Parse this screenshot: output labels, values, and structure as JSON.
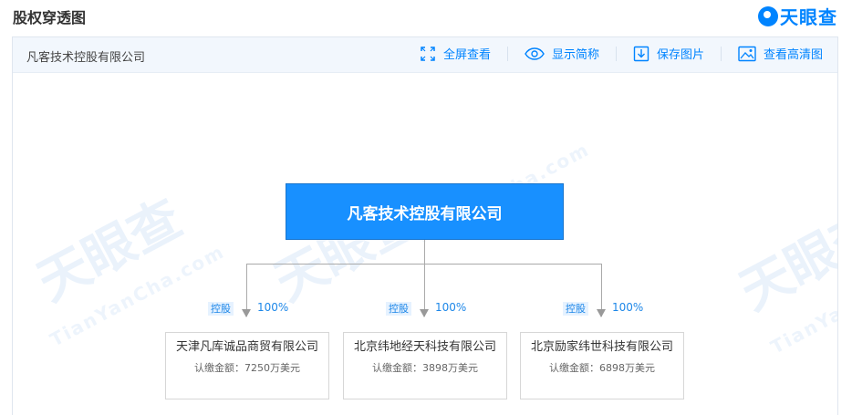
{
  "header": {
    "title": "股权穿透图",
    "brand": "天眼查"
  },
  "toolbar": {
    "company": "凡客技术控股有限公司",
    "tools": [
      {
        "label": "全屏查看",
        "icon": "fullscreen-icon"
      },
      {
        "label": "显示简称",
        "icon": "eye-icon"
      },
      {
        "label": "保存图片",
        "icon": "download-icon"
      },
      {
        "label": "查看高清图",
        "icon": "image-icon"
      }
    ]
  },
  "watermark": {
    "text": "天眼查",
    "sub": "TianYanCha.com"
  },
  "root": {
    "name": "凡客技术控股有限公司"
  },
  "children": [
    {
      "name": "天津凡库诚品商贸有限公司",
      "relation": "控股",
      "percent": "100%",
      "amount": "认缴金额：7250万美元"
    },
    {
      "name": "北京纬地经天科技有限公司",
      "relation": "控股",
      "percent": "100%",
      "amount": "认缴金额：3898万美元"
    },
    {
      "name": "北京励家纬世科技有限公司",
      "relation": "控股",
      "percent": "100%",
      "amount": "认缴金额：6898万美元"
    }
  ],
  "colors": {
    "accent": "#0084ff",
    "root_fill": "#1890ff",
    "connector": "#aaaaaa"
  }
}
